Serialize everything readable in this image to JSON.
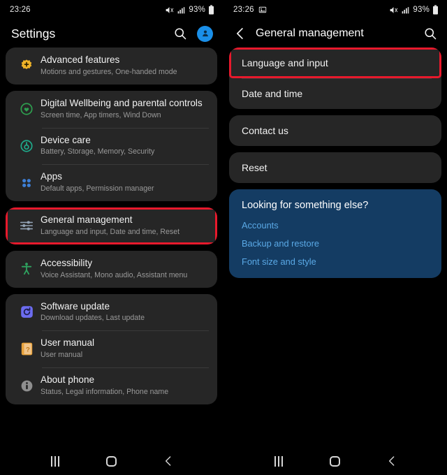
{
  "colors": {
    "accent_red": "#e8192c",
    "card_bg": "#262626",
    "blue_card_bg": "#143c63",
    "blue_link": "#5aa9e6",
    "avatar_blue": "#1a8fe8"
  },
  "left_screen": {
    "status_bar": {
      "time": "23:26",
      "battery_percent": "93%",
      "icons": [
        "mute-icon",
        "signal-bars-icon",
        "battery-icon"
      ]
    },
    "app_bar": {
      "title": "Settings",
      "search_icon": "search-icon",
      "avatar_icon": "account-avatar-icon"
    },
    "groups": [
      {
        "id": "group-advanced",
        "highlighted": false,
        "items": [
          {
            "title": "Advanced features",
            "subtitle": "Motions and gestures, One-handed mode",
            "icon": "advanced-features-icon",
            "icon_color": "#f0b429"
          }
        ]
      },
      {
        "id": "group-wellbeing-apps",
        "highlighted": false,
        "items": [
          {
            "title": "Digital Wellbeing and parental controls",
            "subtitle": "Screen time, App timers, Wind Down",
            "icon": "digital-wellbeing-icon",
            "icon_color": "#2e9e4f"
          },
          {
            "title": "Device care",
            "subtitle": "Battery, Storage, Memory, Security",
            "icon": "device-care-icon",
            "icon_color": "#1fa98a"
          },
          {
            "title": "Apps",
            "subtitle": "Default apps, Permission manager",
            "icon": "apps-grid-icon",
            "icon_color": "#3d7fd6"
          }
        ]
      },
      {
        "id": "group-general-management",
        "highlighted": true,
        "items": [
          {
            "title": "General management",
            "subtitle": "Language and input, Date and time, Reset",
            "icon": "sliders-icon",
            "icon_color": "#93a3b5"
          }
        ]
      },
      {
        "id": "group-accessibility",
        "highlighted": false,
        "items": [
          {
            "title": "Accessibility",
            "subtitle": "Voice Assistant, Mono audio, Assistant menu",
            "icon": "accessibility-person-icon",
            "icon_color": "#2fa360"
          }
        ]
      },
      {
        "id": "group-system",
        "highlighted": false,
        "items": [
          {
            "title": "Software update",
            "subtitle": "Download updates, Last update",
            "icon": "software-update-icon",
            "icon_color": "#6c6cf0"
          },
          {
            "title": "User manual",
            "subtitle": "User manual",
            "icon": "user-manual-icon",
            "icon_color": "#e8a33d"
          },
          {
            "title": "About phone",
            "subtitle": "Status, Legal information, Phone name",
            "icon": "info-icon",
            "icon_color": "#9a9a9a"
          }
        ]
      }
    ],
    "nav_bar": {
      "recents_label": "recents-button",
      "home_label": "home-button",
      "back_label": "back-button"
    }
  },
  "right_screen": {
    "status_bar": {
      "time": "23:26",
      "battery_percent": "93%",
      "notification_icon": "image-notification-icon",
      "icons": [
        "mute-icon",
        "signal-bars-icon",
        "battery-icon"
      ]
    },
    "app_bar": {
      "back_icon": "back-chevron-icon",
      "title": "General management",
      "search_icon": "search-icon"
    },
    "groups": [
      {
        "id": "group-language-date",
        "items": [
          {
            "title": "Language and input",
            "highlighted": true
          },
          {
            "title": "Date and time",
            "highlighted": false
          }
        ]
      },
      {
        "id": "group-contact",
        "items": [
          {
            "title": "Contact us",
            "highlighted": false
          }
        ]
      },
      {
        "id": "group-reset",
        "items": [
          {
            "title": "Reset",
            "highlighted": false
          }
        ]
      }
    ],
    "suggestion_card": {
      "heading": "Looking for something else?",
      "links": [
        "Accounts",
        "Backup and restore",
        "Font size and style"
      ]
    },
    "nav_bar": {
      "recents_label": "recents-button",
      "home_label": "home-button",
      "back_label": "back-button"
    }
  }
}
